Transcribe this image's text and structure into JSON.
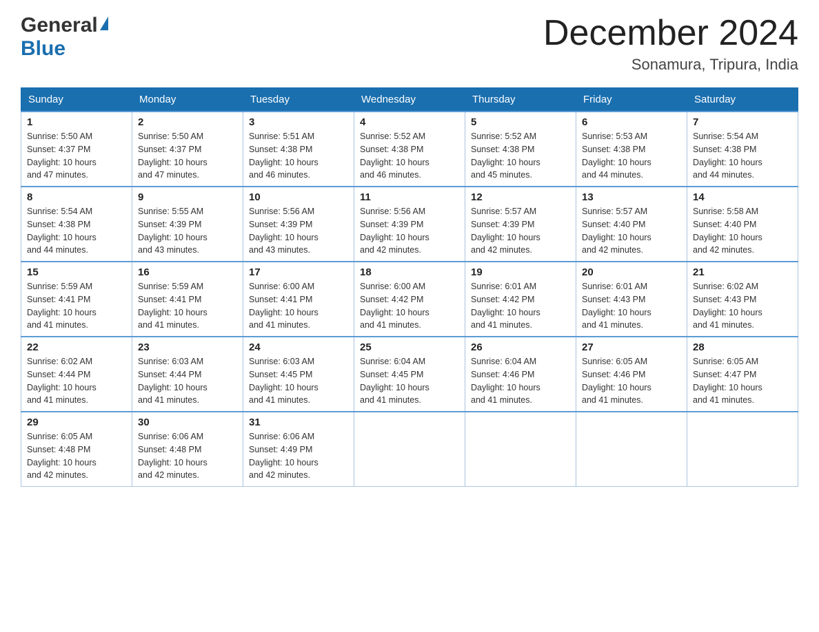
{
  "logo": {
    "general": "General",
    "blue": "Blue"
  },
  "title": {
    "month": "December 2024",
    "location": "Sonamura, Tripura, India"
  },
  "weekdays": [
    "Sunday",
    "Monday",
    "Tuesday",
    "Wednesday",
    "Thursday",
    "Friday",
    "Saturday"
  ],
  "weeks": [
    [
      {
        "day": "1",
        "sunrise": "5:50 AM",
        "sunset": "4:37 PM",
        "daylight": "10 hours and 47 minutes."
      },
      {
        "day": "2",
        "sunrise": "5:50 AM",
        "sunset": "4:37 PM",
        "daylight": "10 hours and 47 minutes."
      },
      {
        "day": "3",
        "sunrise": "5:51 AM",
        "sunset": "4:38 PM",
        "daylight": "10 hours and 46 minutes."
      },
      {
        "day": "4",
        "sunrise": "5:52 AM",
        "sunset": "4:38 PM",
        "daylight": "10 hours and 46 minutes."
      },
      {
        "day": "5",
        "sunrise": "5:52 AM",
        "sunset": "4:38 PM",
        "daylight": "10 hours and 45 minutes."
      },
      {
        "day": "6",
        "sunrise": "5:53 AM",
        "sunset": "4:38 PM",
        "daylight": "10 hours and 44 minutes."
      },
      {
        "day": "7",
        "sunrise": "5:54 AM",
        "sunset": "4:38 PM",
        "daylight": "10 hours and 44 minutes."
      }
    ],
    [
      {
        "day": "8",
        "sunrise": "5:54 AM",
        "sunset": "4:38 PM",
        "daylight": "10 hours and 44 minutes."
      },
      {
        "day": "9",
        "sunrise": "5:55 AM",
        "sunset": "4:39 PM",
        "daylight": "10 hours and 43 minutes."
      },
      {
        "day": "10",
        "sunrise": "5:56 AM",
        "sunset": "4:39 PM",
        "daylight": "10 hours and 43 minutes."
      },
      {
        "day": "11",
        "sunrise": "5:56 AM",
        "sunset": "4:39 PM",
        "daylight": "10 hours and 42 minutes."
      },
      {
        "day": "12",
        "sunrise": "5:57 AM",
        "sunset": "4:39 PM",
        "daylight": "10 hours and 42 minutes."
      },
      {
        "day": "13",
        "sunrise": "5:57 AM",
        "sunset": "4:40 PM",
        "daylight": "10 hours and 42 minutes."
      },
      {
        "day": "14",
        "sunrise": "5:58 AM",
        "sunset": "4:40 PM",
        "daylight": "10 hours and 42 minutes."
      }
    ],
    [
      {
        "day": "15",
        "sunrise": "5:59 AM",
        "sunset": "4:41 PM",
        "daylight": "10 hours and 41 minutes."
      },
      {
        "day": "16",
        "sunrise": "5:59 AM",
        "sunset": "4:41 PM",
        "daylight": "10 hours and 41 minutes."
      },
      {
        "day": "17",
        "sunrise": "6:00 AM",
        "sunset": "4:41 PM",
        "daylight": "10 hours and 41 minutes."
      },
      {
        "day": "18",
        "sunrise": "6:00 AM",
        "sunset": "4:42 PM",
        "daylight": "10 hours and 41 minutes."
      },
      {
        "day": "19",
        "sunrise": "6:01 AM",
        "sunset": "4:42 PM",
        "daylight": "10 hours and 41 minutes."
      },
      {
        "day": "20",
        "sunrise": "6:01 AM",
        "sunset": "4:43 PM",
        "daylight": "10 hours and 41 minutes."
      },
      {
        "day": "21",
        "sunrise": "6:02 AM",
        "sunset": "4:43 PM",
        "daylight": "10 hours and 41 minutes."
      }
    ],
    [
      {
        "day": "22",
        "sunrise": "6:02 AM",
        "sunset": "4:44 PM",
        "daylight": "10 hours and 41 minutes."
      },
      {
        "day": "23",
        "sunrise": "6:03 AM",
        "sunset": "4:44 PM",
        "daylight": "10 hours and 41 minutes."
      },
      {
        "day": "24",
        "sunrise": "6:03 AM",
        "sunset": "4:45 PM",
        "daylight": "10 hours and 41 minutes."
      },
      {
        "day": "25",
        "sunrise": "6:04 AM",
        "sunset": "4:45 PM",
        "daylight": "10 hours and 41 minutes."
      },
      {
        "day": "26",
        "sunrise": "6:04 AM",
        "sunset": "4:46 PM",
        "daylight": "10 hours and 41 minutes."
      },
      {
        "day": "27",
        "sunrise": "6:05 AM",
        "sunset": "4:46 PM",
        "daylight": "10 hours and 41 minutes."
      },
      {
        "day": "28",
        "sunrise": "6:05 AM",
        "sunset": "4:47 PM",
        "daylight": "10 hours and 41 minutes."
      }
    ],
    [
      {
        "day": "29",
        "sunrise": "6:05 AM",
        "sunset": "4:48 PM",
        "daylight": "10 hours and 42 minutes."
      },
      {
        "day": "30",
        "sunrise": "6:06 AM",
        "sunset": "4:48 PM",
        "daylight": "10 hours and 42 minutes."
      },
      {
        "day": "31",
        "sunrise": "6:06 AM",
        "sunset": "4:49 PM",
        "daylight": "10 hours and 42 minutes."
      },
      null,
      null,
      null,
      null
    ]
  ],
  "labels": {
    "sunrise": "Sunrise:",
    "sunset": "Sunset:",
    "daylight": "Daylight:"
  }
}
